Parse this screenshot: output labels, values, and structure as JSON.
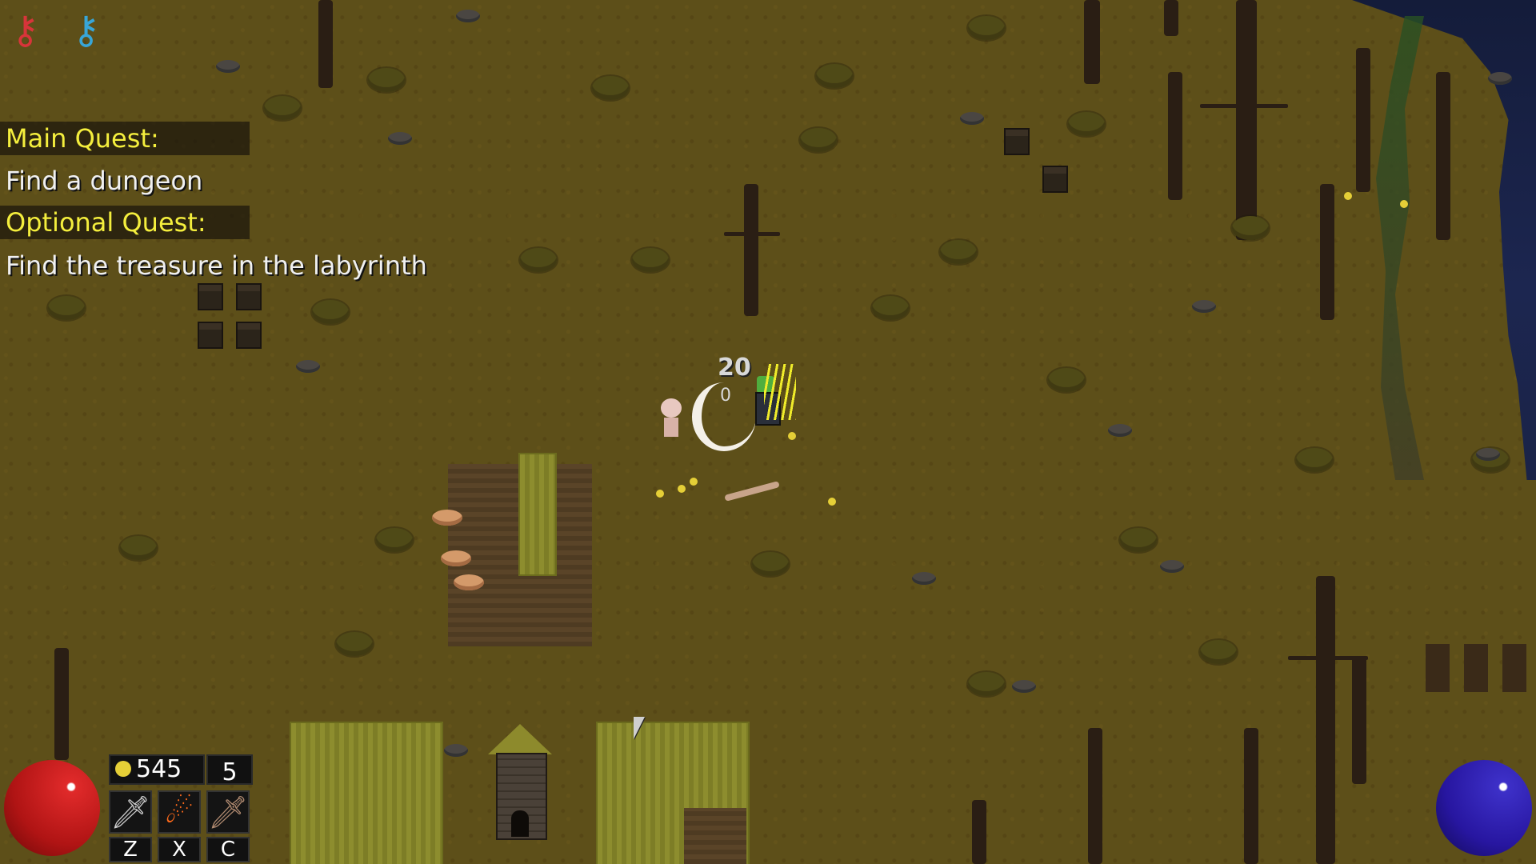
{
  "keys": [
    {
      "name": "red-key",
      "color": "#d8343a",
      "glyph": "⚷"
    },
    {
      "name": "blue-key",
      "color": "#38a6d8",
      "glyph": "⚷"
    }
  ],
  "quests": {
    "main_header": "Main Quest:",
    "main_text": "Find a dungeon",
    "optional_header": "Optional Quest:",
    "optional_text": "Find the treasure in the labyrinth"
  },
  "combat_text": {
    "damage": "20",
    "small": "0"
  },
  "hud": {
    "gold": "545",
    "level": "5",
    "skills": [
      {
        "name": "sword-icon",
        "hotkey": "Z",
        "glyph": "🗡"
      },
      {
        "name": "fireball-icon",
        "hotkey": "X",
        "glyph": "☄"
      },
      {
        "name": "dagger-icon",
        "hotkey": "C",
        "glyph": "🗡"
      }
    ],
    "gold_icon": "coin-icon"
  },
  "colors": {
    "health_orb": "#c3161a",
    "mana_orb": "#2c1ea5",
    "quest_header": "#f4ee3d"
  }
}
